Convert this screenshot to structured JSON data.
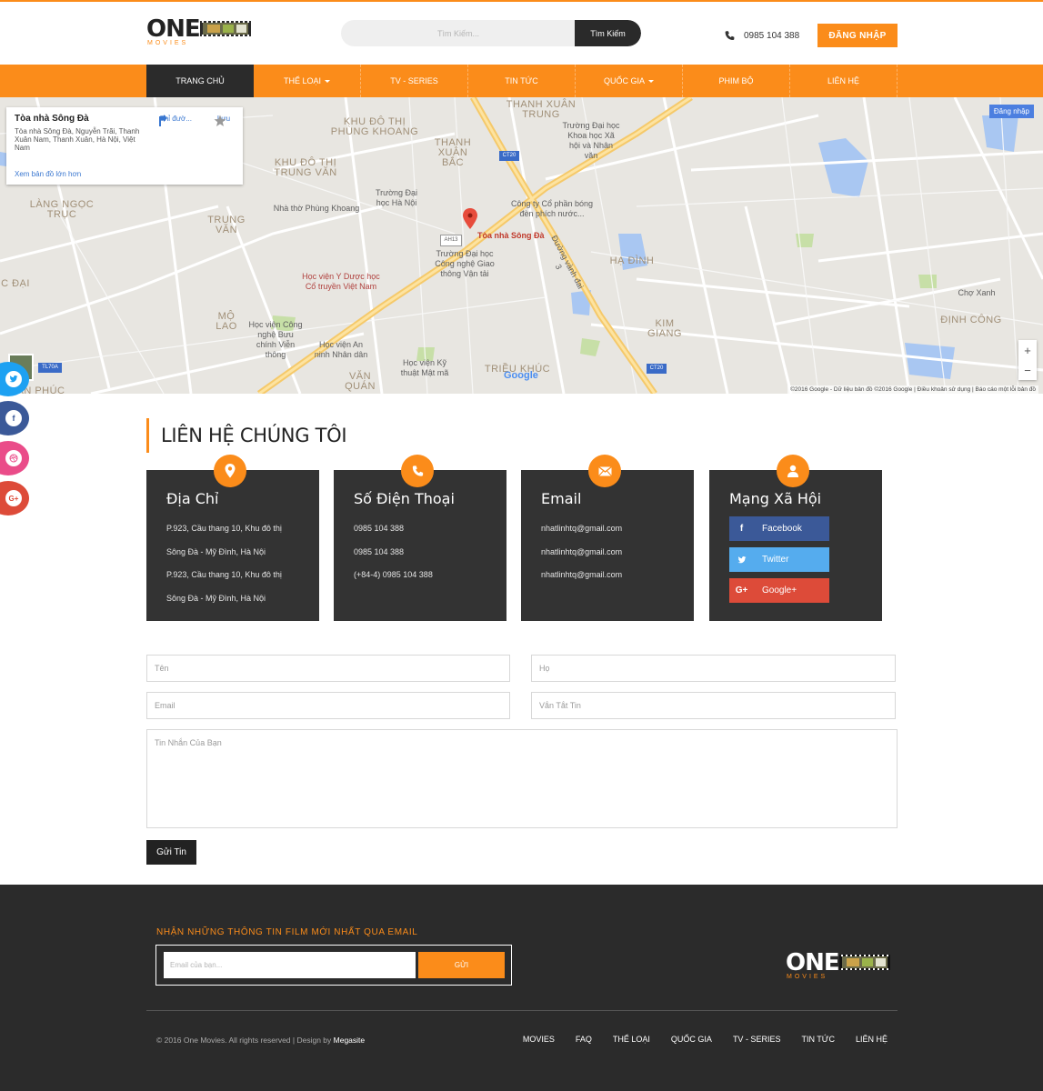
{
  "header": {
    "logo_text": "ONE",
    "logo_sub": "MOVIES",
    "search_placeholder": "Tìm Kiếm...",
    "search_button": "Tìm Kiếm",
    "phone": "0985 104 388",
    "login_button": "ĐĂNG NHẬP"
  },
  "nav": {
    "items": [
      {
        "label": "TRANG CHỦ"
      },
      {
        "label": "THỂ LOẠI"
      },
      {
        "label": "TV - SERIES"
      },
      {
        "label": "TIN TỨC"
      },
      {
        "label": "QUỐC GIA"
      },
      {
        "label": "PHIM BỘ"
      },
      {
        "label": "LIÊN HỆ"
      }
    ]
  },
  "map": {
    "card_name": "Tòa nhà Sông Đà",
    "card_address": "Tòa nhà Sông Đà, Nguyễn Trãi, Thanh Xuân Nam, Thanh Xuân, Hà Nội, Việt Nam",
    "card_link": "Xem bản đồ lớn hơn",
    "directions": "Chỉ đườ...",
    "save": "Lưu",
    "signin": "Đăng nhập",
    "marker": "Tòa nhà Sông Đà",
    "google": "Google",
    "attribution": "©2016 Google - Dữ liệu bản đồ ©2016 Google  |  Điều khoản sử dụng  |  Báo cáo một lỗi bản đồ",
    "zoom_in": "+",
    "zoom_out": "−",
    "labels": {
      "khu_do_thi_phung_khoang": "KHU ĐÔ THỊ PHÙNG KHOANG",
      "khu_do_thi_trung_van": "KHU ĐÔ THỊ TRUNG VĂN",
      "lang_ngoc_truc": "LÀNG NGỌC TRỤC",
      "trung_van": "TRUNG VĂN",
      "thanh_xuan_bac": "THANH XUÂN BẮC",
      "thanh_xuan_trung": "THANH XUÂN TRUNG",
      "ha_dinh": "HẠ ĐÌNH",
      "kim_giang": "KIM GIANG",
      "dinh_cong": "ĐỊNH CÔNG",
      "mo_lao": "MỘ LAO",
      "van_quan": "VĂN QUÁN",
      "trieu_khuc": "TRIỀU KHÚC",
      "dai": "C ĐẠI",
      "an_phuc": "AN PHÚC",
      "nha_tho": "Nhà thờ Phùng Khoang",
      "dh_ha_noi": "Trường Đại học Hà Nội",
      "dh_khxh": "Trường Đại học Khoa học Xã hội và Nhân văn",
      "cong_ty": "Công ty Cổ phần bóng đèn phích nước...",
      "dh_gtvt": "Trường Đại học Công nghệ Giao thông Vận tải",
      "hv_yduoc": "Học viện Y Dược học Cổ truyền Việt Nam",
      "hv_buu_chinh": "Học viện Công nghệ Bưu chính Viễn thông",
      "hv_an_ninh": "Học viện An ninh Nhân dân",
      "hv_ky_thuat": "Học viện Kỹ thuật Mật mã",
      "cho_xanh": "Chợ Xanh",
      "duong_vanh_dai": "Đường vành đai 3",
      "ah13": "AH13",
      "ct20": "CT20",
      "tl70a": "TL70A"
    }
  },
  "social_float": [
    "twitter",
    "facebook",
    "dribbble",
    "google-plus"
  ],
  "contact": {
    "title": "LIÊN HỆ CHÚNG TÔI",
    "cards": [
      {
        "title": "Địa Chỉ",
        "lines": [
          "P.923, Cầu thang 10, Khu đô thị",
          "Sông Đà - Mỹ Đình, Hà Nội",
          "P.923, Cầu thang 10, Khu đô thị",
          "Sông Đà - Mỹ Đình, Hà Nội"
        ]
      },
      {
        "title": "Số Điện Thoại",
        "lines": [
          "0985 104 388",
          "0985 104 388",
          "(+84-4) 0985 104 388"
        ]
      },
      {
        "title": "Email",
        "lines": [
          "nhatlinhtq@gmail.com",
          "nhatlinhtq@gmail.com",
          "nhatlinhtq@gmail.com"
        ]
      },
      {
        "title": "Mạng Xã Hội",
        "buttons": [
          {
            "label": "Facebook",
            "color": "#3b5998"
          },
          {
            "label": "Twitter",
            "color": "#55acee"
          },
          {
            "label": "Google+",
            "color": "#dd4b39"
          }
        ]
      }
    ],
    "accent": "#fb8c1a"
  },
  "form": {
    "first_name": "Tên",
    "last_name": "Họ",
    "email": "Email",
    "subject": "Vắn Tắt Tin",
    "message": "Tin Nhắn Của Bạn",
    "submit": "Gửi Tin"
  },
  "footer": {
    "newsletter_title": "NHẬN NHỮNG THÔNG TIN FILM MỚI NHẤT QUA EMAIL",
    "email_placeholder": "Email của bạn...",
    "send": "GỬI",
    "copyright": "© 2016 One Movies. All rights reserved | Design by",
    "designer": "Megasite",
    "links": [
      "MOVIES",
      "FAQ",
      "THỂ LOẠI",
      "QUỐC GIA",
      "TV - SERIES",
      "TIN TỨC",
      "LIÊN HỆ"
    ]
  }
}
